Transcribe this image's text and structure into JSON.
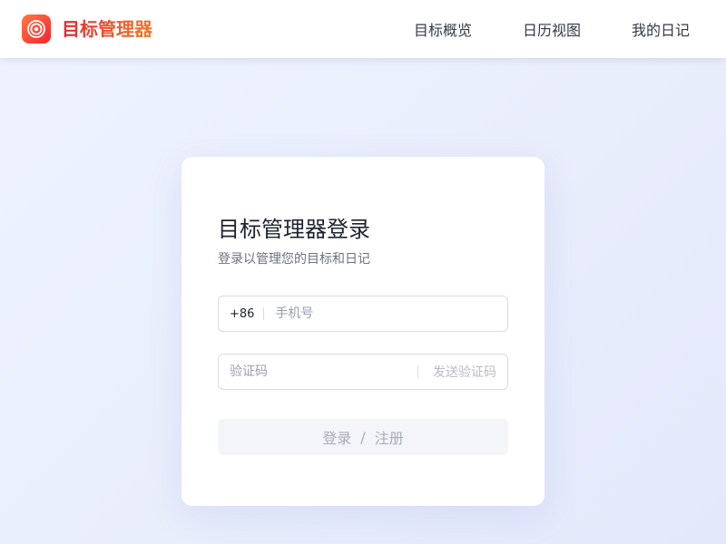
{
  "header": {
    "brand": "目标管理器",
    "logo_icon": "target-icon",
    "logo_gradient": [
      "#ff7a45",
      "#f5222d"
    ],
    "nav": [
      {
        "label": "目标概览"
      },
      {
        "label": "日历视图"
      },
      {
        "label": "我的日记"
      }
    ]
  },
  "login": {
    "title": "目标管理器登录",
    "subtitle": "登录以管理您的目标和日记",
    "phone": {
      "prefix": "+86",
      "value": "",
      "placeholder": "手机号"
    },
    "code": {
      "value": "",
      "placeholder": "验证码",
      "send_label": "发送验证码"
    },
    "submit": {
      "login_label": "登录",
      "separator": "/",
      "register_label": "注册"
    }
  }
}
